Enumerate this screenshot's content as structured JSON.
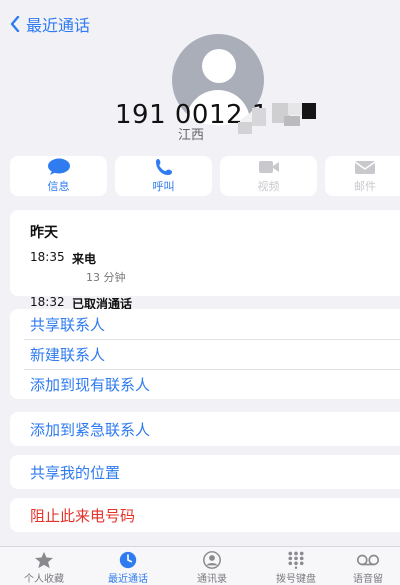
{
  "header": {
    "back_label": "最近通话"
  },
  "contact": {
    "number": "191 0012 1",
    "region": "江西",
    "avatar_icon": "person-icon"
  },
  "actions": [
    {
      "label": "信息",
      "icon": "message-icon",
      "enabled": true
    },
    {
      "label": "呼叫",
      "icon": "phone-icon",
      "enabled": true
    },
    {
      "label": "视频",
      "icon": "video-icon",
      "enabled": false
    },
    {
      "label": "邮件",
      "icon": "mail-icon",
      "enabled": false
    }
  ],
  "recent": {
    "day": "昨天",
    "calls": [
      {
        "time": "18:35",
        "type": "来电",
        "duration": "13 分钟"
      },
      {
        "time": "18:32",
        "type": "已取消通话"
      }
    ]
  },
  "options": {
    "share_contact": "共享联系人",
    "new_contact": "新建联系人",
    "add_existing": "添加到现有联系人",
    "add_emergency": "添加到紧急联系人",
    "share_location": "共享我的位置",
    "block_caller": "阻止此来电号码"
  },
  "tabs": [
    {
      "label": "个人收藏",
      "icon": "star-icon",
      "active": false
    },
    {
      "label": "最近通话",
      "icon": "clock-icon",
      "active": true
    },
    {
      "label": "通讯录",
      "icon": "contacts-icon",
      "active": false
    },
    {
      "label": "拨号键盘",
      "icon": "keypad-icon",
      "active": false
    },
    {
      "label": "语音留",
      "icon": "voicemail-icon",
      "active": false
    }
  ],
  "colors": {
    "accent": "#2f7bf0",
    "danger": "#e5332a",
    "background": "#f2f2f6"
  }
}
